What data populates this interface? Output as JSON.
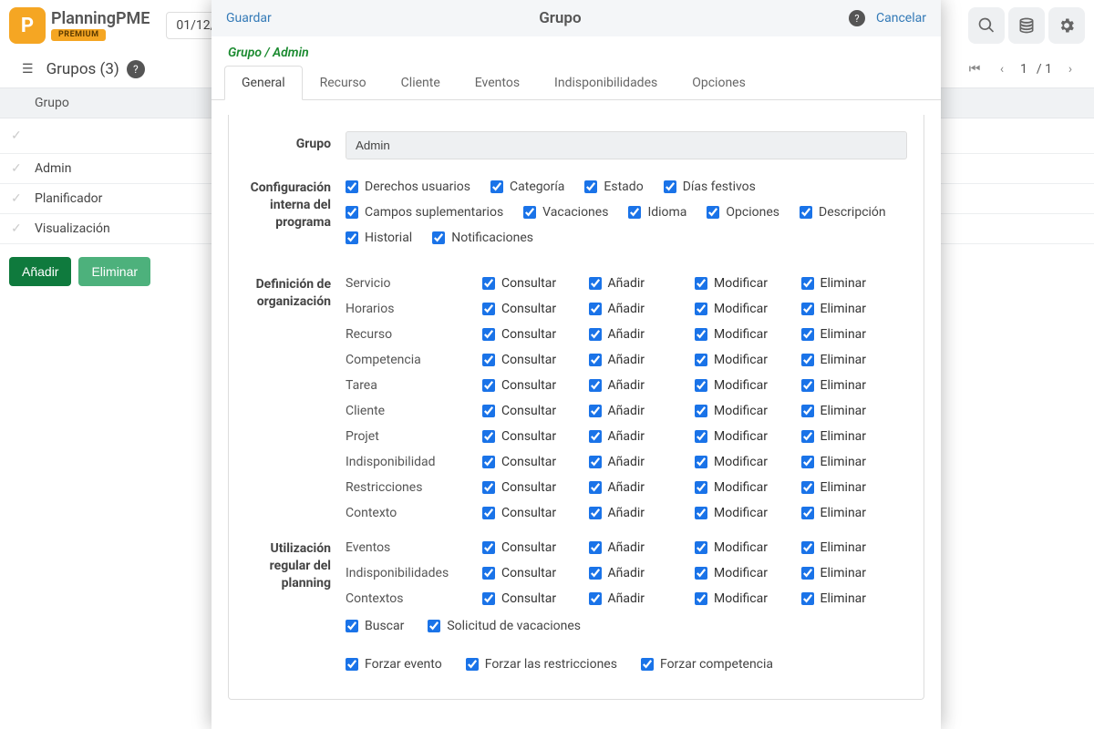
{
  "brand": {
    "name": "PlanningPME",
    "badge": "PREMIUM"
  },
  "topbar": {
    "date": "01/12/..."
  },
  "page": {
    "title": "Grupos (3)"
  },
  "pager": {
    "current": "1",
    "total": "/ 1"
  },
  "list": {
    "header": "Grupo",
    "rows": [
      "Admin",
      "Planificador",
      "Visualización"
    ]
  },
  "buttons": {
    "add": "Añadir",
    "delete": "Eliminar"
  },
  "modal": {
    "save": "Guardar",
    "title": "Grupo",
    "cancel": "Cancelar",
    "breadcrumb": "Grupo / Admin",
    "tabs": [
      "General",
      "Recurso",
      "Cliente",
      "Eventos",
      "Indisponibilidades",
      "Opciones"
    ],
    "group_label": "Grupo",
    "group_value": "Admin",
    "sections": {
      "config_label": "Configuración interna del programa",
      "config_items": [
        "Derechos usuarios",
        "Categoría",
        "Estado",
        "Días festivos",
        "Campos suplementarios",
        "Vacaciones",
        "Idioma",
        "Opciones",
        "Descripción",
        "Historial",
        "Notificaciones"
      ],
      "org_label": "Definición de organización",
      "crud_cols": [
        "Consultar",
        "Añadir",
        "Modificar",
        "Eliminar"
      ],
      "org_rows": [
        "Servicio",
        "Horarios",
        "Recurso",
        "Competencia",
        "Tarea",
        "Cliente",
        "Projet",
        "Indisponibilidad",
        "Restricciones",
        "Contexto"
      ],
      "usage_label": "Utilización regular del planning",
      "usage_rows": [
        "Eventos",
        "Indisponibilidades",
        "Contextos"
      ],
      "extra1": [
        "Buscar",
        "Solicitud de vacaciones"
      ],
      "extra2": [
        "Forzar evento",
        "Forzar las restricciones",
        "Forzar competencia"
      ]
    }
  }
}
